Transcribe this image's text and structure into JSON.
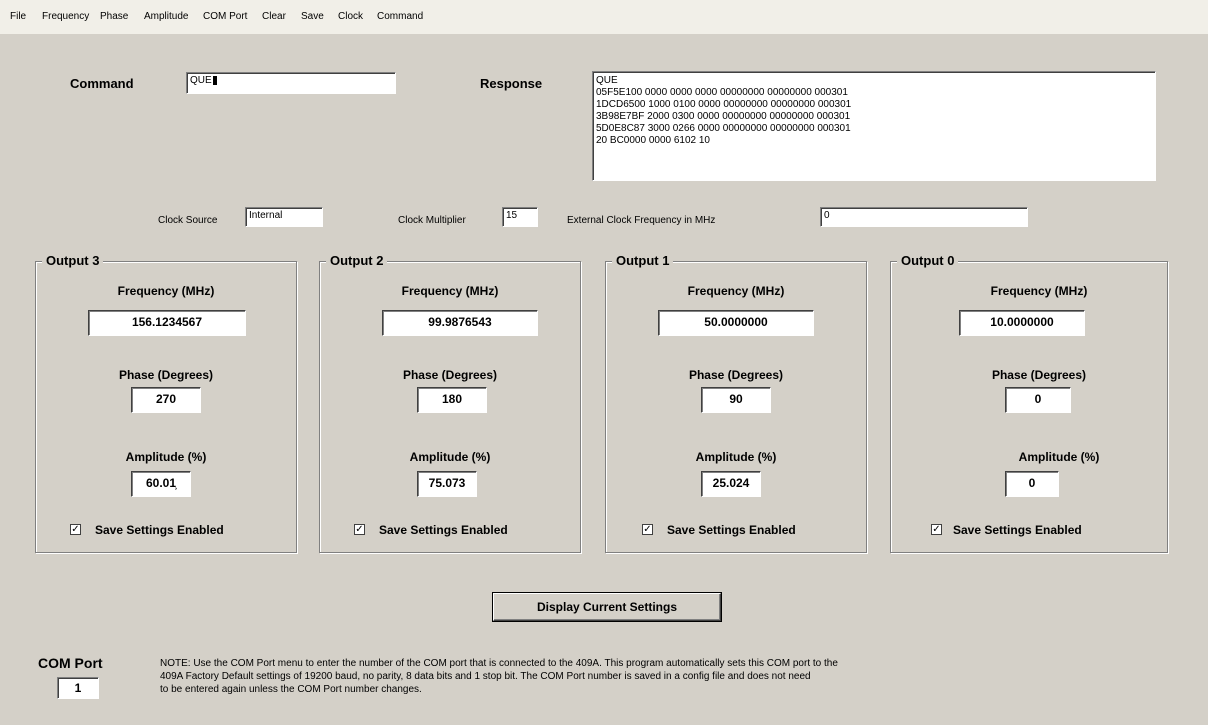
{
  "menu": [
    "File",
    "Frequency",
    "Phase",
    "Amplitude",
    "COM Port",
    "Clear",
    "Save",
    "Clock",
    "Command"
  ],
  "command": {
    "label": "Command",
    "value": "QUE"
  },
  "response": {
    "label": "Response",
    "lines": [
      "QUE",
      "05F5E100 0000 0000 0000 00000000 00000000 000301",
      "1DCD6500 1000 0100 0000 00000000 00000000 000301",
      "3B98E7BF 2000 0300 0000 00000000 00000000 000301",
      "5D0E8C87 3000 0266 0000 00000000 00000000 000301",
      "20 BC0000 0000 6102 10"
    ]
  },
  "clock": {
    "source_label": "Clock Source",
    "source_value": "Internal",
    "multiplier_label": "Clock Multiplier",
    "multiplier_value": "15",
    "ext_label": "External Clock Frequency in MHz",
    "ext_value": "0"
  },
  "outputs": [
    {
      "title": "Output 3",
      "freq_label": "Frequency (MHz)",
      "freq": "156.1234567",
      "phase_label": "Phase (Degrees)",
      "phase": "270",
      "amp_label": "Amplitude (%)",
      "amp": "60.01̹",
      "save_label": "Save Settings Enabled",
      "checked": true
    },
    {
      "title": "Output 2",
      "freq_label": "Frequency (MHz)",
      "freq": "99.9876543",
      "phase_label": "Phase (Degrees)",
      "phase": "180",
      "amp_label": "Amplitude (%)",
      "amp": "75.073",
      "save_label": "Save Settings Enabled",
      "checked": true
    },
    {
      "title": "Output 1",
      "freq_label": "Frequency (MHz)",
      "freq": "50.0000000",
      "phase_label": "Phase (Degrees)",
      "phase": "90",
      "amp_label": "Amplitude (%)",
      "amp": "25.024",
      "save_label": "Save Settings Enabled",
      "checked": true
    },
    {
      "title": "Output 0",
      "freq_label": "Frequency (MHz)",
      "freq": "10.0000000",
      "phase_label": "Phase (Degrees)",
      "phase": "0",
      "amp_label": "Amplitude (%)",
      "amp": "0",
      "save_label": "Save Settings Enabled",
      "checked": true
    }
  ],
  "display_button": "Display Current Settings",
  "com_port": {
    "label": "COM Port",
    "value": "1"
  },
  "note": [
    "NOTE: Use the COM Port menu to enter the number of the COM port that is connected to the 409A.  This program automatically sets this COM port to the",
    "409A Factory Default settings of 19200 baud, no parity, 8 data bits and  1 stop bit.  The COM Port number is saved in a config file and does not need",
    "to be entered again unless the COM Port number changes."
  ]
}
